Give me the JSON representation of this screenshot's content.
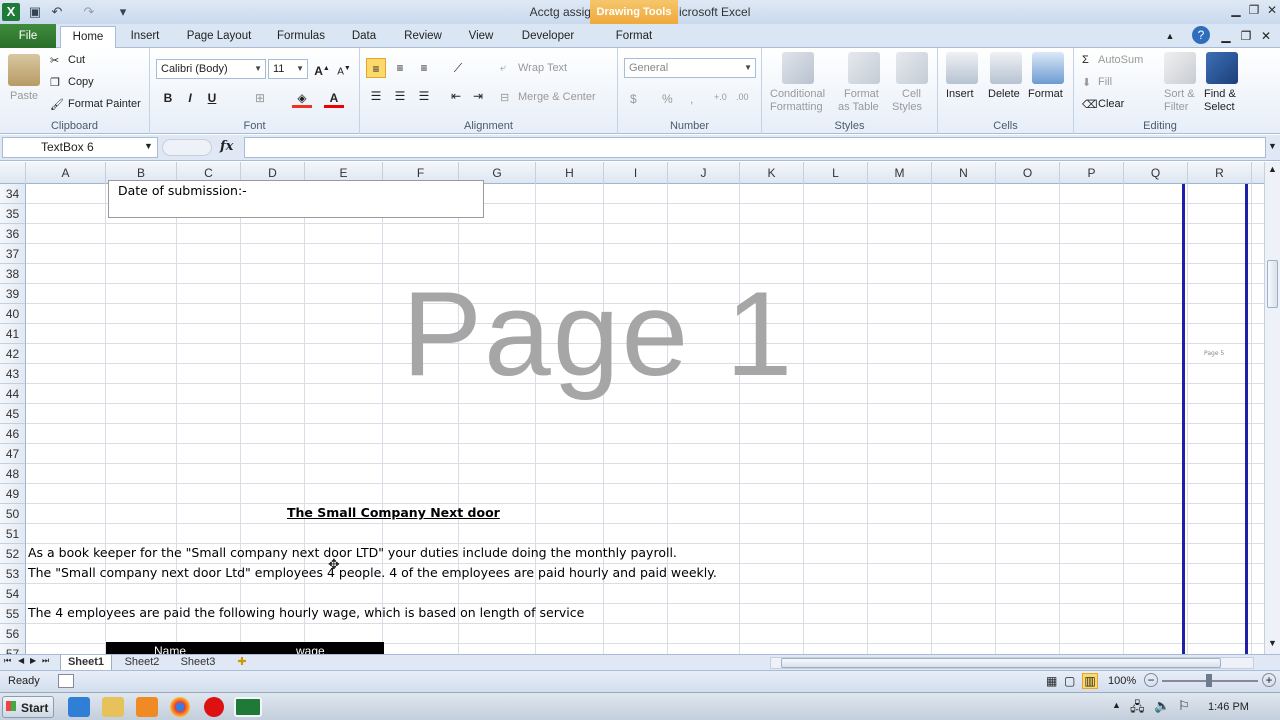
{
  "window": {
    "title": "Acctg assignment 3.xlsx  -  Microsoft Excel",
    "context_tab": "Drawing Tools"
  },
  "tabs": [
    "File",
    "Home",
    "Insert",
    "Page Layout",
    "Formulas",
    "Data",
    "Review",
    "View",
    "Developer",
    "Format"
  ],
  "ribbon": {
    "clipboard": {
      "paste": "Paste",
      "cut": "Cut",
      "copy": "Copy",
      "format_painter": "Format Painter",
      "label": "Clipboard"
    },
    "font": {
      "name": "Calibri (Body)",
      "size": "11",
      "bold": "B",
      "italic": "I",
      "underline": "U",
      "label": "Font"
    },
    "alignment": {
      "wrap": "Wrap Text",
      "merge": "Merge & Center",
      "label": "Alignment"
    },
    "number": {
      "format": "General",
      "currency": "$",
      "percent": "%",
      "comma": ",",
      "label": "Number"
    },
    "styles": {
      "conditional": "Conditional",
      "conditional2": "Formatting",
      "format_table": "Format",
      "format_table2": "as Table",
      "cell_styles": "Cell",
      "cell_styles2": "Styles",
      "label": "Styles"
    },
    "cells": {
      "insert": "Insert",
      "delete": "Delete",
      "format": "Format",
      "label": "Cells"
    },
    "editing": {
      "autosum": "AutoSum",
      "fill": "Fill",
      "clear": "Clear",
      "sort": "Sort &",
      "sort2": "Filter",
      "find": "Find &",
      "find2": "Select",
      "label": "Editing"
    }
  },
  "formula_bar": {
    "name_box": "TextBox 6",
    "fx": "fx",
    "value": ""
  },
  "columns": [
    "A",
    "B",
    "C",
    "D",
    "E",
    "F",
    "G",
    "H",
    "I",
    "J",
    "K",
    "L",
    "M",
    "N",
    "O",
    "P",
    "Q",
    "R"
  ],
  "rows": [
    "34",
    "35",
    "36",
    "37",
    "38",
    "39",
    "40",
    "41",
    "42",
    "43",
    "44",
    "45",
    "46",
    "47",
    "48",
    "49",
    "50",
    "51",
    "52",
    "53",
    "54",
    "55",
    "56",
    "57"
  ],
  "sheet": {
    "textbox_text": "Date of submission:-",
    "watermark": "Page 1",
    "side_label": "Page 5",
    "heading": "The Small Company Next door",
    "line52": "As a book keeper for the \"Small company next door LTD\" your duties include doing the monthly payroll.",
    "line53": "The \"Small company next door Ltd\" employees 4 people. 4 of the employees are paid hourly and paid weekly.",
    "line55": "The 4 employees are paid the following hourly wage, which is based on length of service",
    "table_h1": "Name",
    "table_h2": "wage"
  },
  "sheet_tabs": [
    "Sheet1",
    "Sheet2",
    "Sheet3"
  ],
  "status": {
    "ready": "Ready",
    "zoom": "100%"
  },
  "taskbar": {
    "start": "Start",
    "time": "1:46 PM"
  },
  "colors": {
    "file_tab": "#2f7a2e",
    "drawing_tools": "#f0a93a",
    "page_break_line": "#1f1fa8"
  }
}
